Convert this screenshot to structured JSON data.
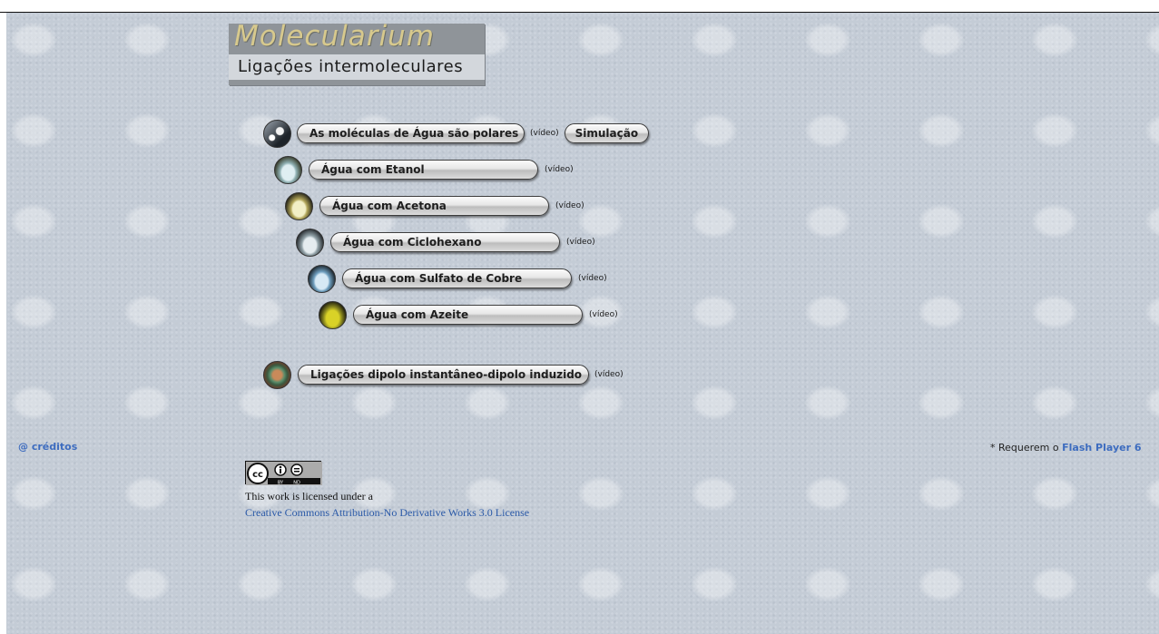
{
  "logo": {
    "title": "Molecularium",
    "subtitle": "Ligações intermoleculares"
  },
  "menu": [
    {
      "label": "As moléculas de Água são polares",
      "video": "(vídeo)",
      "extra": "Simulação",
      "thumb": "water-molecule-icon"
    },
    {
      "label": "Água com Etanol",
      "video": "(vídeo)",
      "thumb": "beaker-ethanol-icon"
    },
    {
      "label": "Água com Acetona",
      "video": "(vídeo)",
      "thumb": "beaker-acetone-icon"
    },
    {
      "label": "Água com Ciclohexano",
      "video": "(vídeo)",
      "thumb": "beaker-cyclohexane-icon"
    },
    {
      "label": "Água com Sulfato de Cobre",
      "video": "(vídeo)",
      "thumb": "beaker-copper-sulfate-icon"
    },
    {
      "label": "Água com Azeite",
      "video": "(vídeo)",
      "thumb": "beaker-olive-oil-icon"
    },
    {
      "label": "Ligações dipolo instantâneo-dipolo induzido",
      "video": "(vídeo)",
      "thumb": "dipole-atom-icon"
    }
  ],
  "footer": {
    "credits": "@ créditos",
    "flash_prefix": "* Requerem o ",
    "flash_link": "Flash Player 6",
    "license_line": "This work is licensed under a",
    "license_link": "Creative Commons Attribution-No Derivative Works 3.0 License",
    "cc_badge": {
      "by": "BY",
      "nd": "ND"
    }
  },
  "colors": {
    "background": "#c4ccd6",
    "link": "#3d6cbf",
    "logo_gold": "#d7c98d"
  }
}
